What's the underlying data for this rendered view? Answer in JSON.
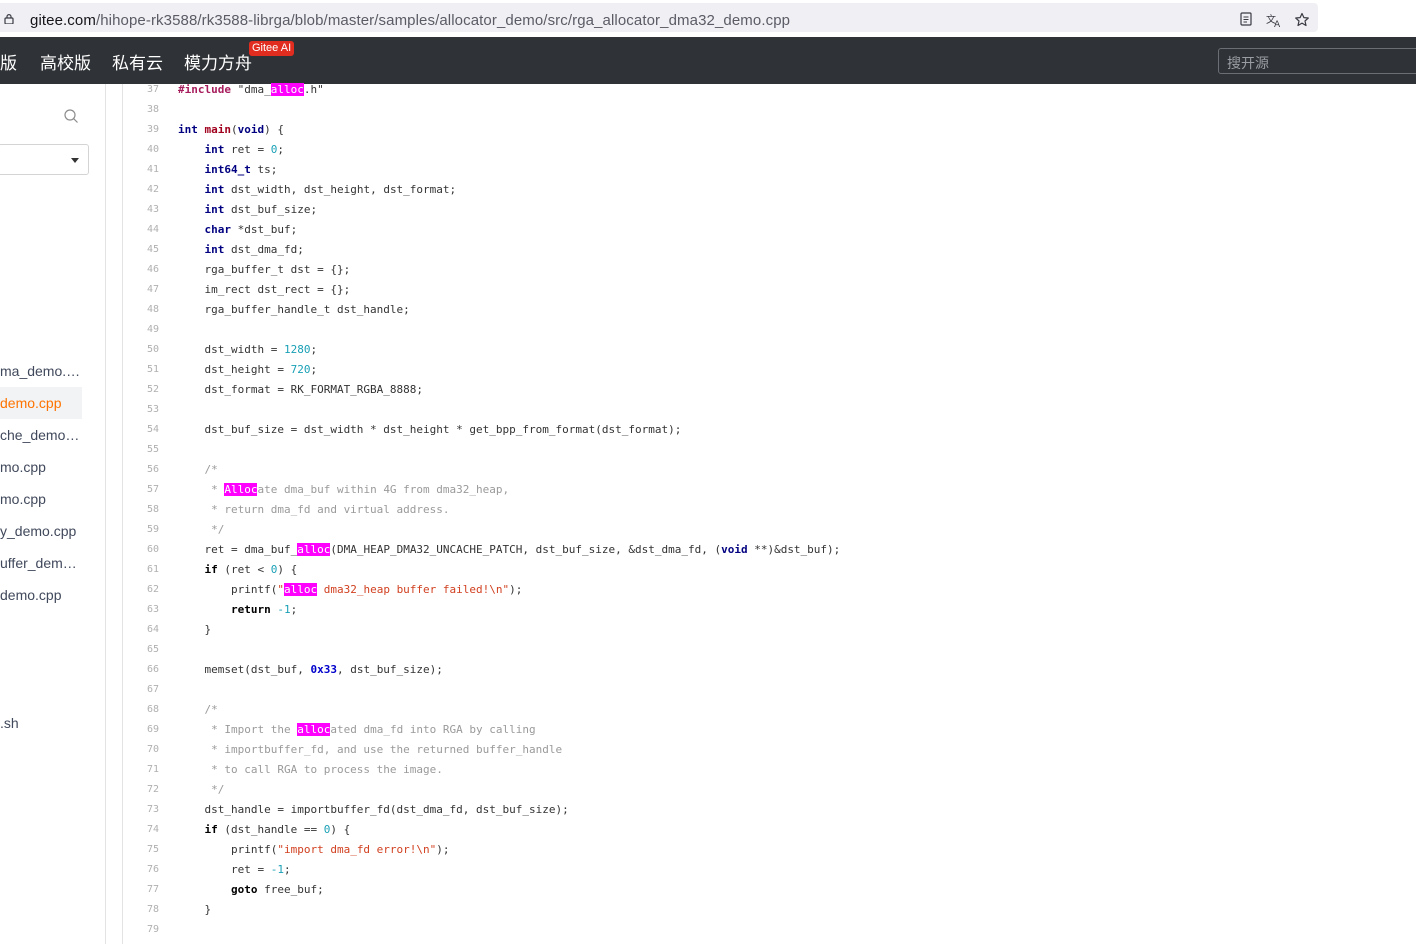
{
  "browser": {
    "url_host": "gitee.com",
    "url_path": "/hihope-rk3588/rk3588-librga/blob/master/samples/allocator_demo/src/rga_allocator_dma32_demo.cpp",
    "icons": [
      "lock-icon",
      "reader-icon",
      "translate-icon",
      "bookmark-star-icon"
    ]
  },
  "nav": {
    "items": [
      "版",
      "高校版",
      "私有云",
      "模力方舟"
    ],
    "badge": "Gitee AI",
    "search_placeholder": "搜开源"
  },
  "sidebar": {
    "files": [
      "ma_demo.cpp",
      "demo.cpp",
      "che_demo.cpp",
      "mo.cpp",
      "mo.cpp",
      "y_demo.cpp",
      "uffer_demo.cpp",
      "demo.cpp",
      ".sh"
    ],
    "active_index": 1
  },
  "code": {
    "lines": [
      {
        "n": "37",
        "tokens": [
          [
            "pp",
            "#include "
          ],
          [
            "",
            "\"dma_"
          ],
          [
            "hl",
            "alloc"
          ],
          [
            "",
            ".h\""
          ]
        ]
      },
      {
        "n": "38",
        "tokens": []
      },
      {
        "n": "39",
        "tokens": [
          [
            "kw",
            "int "
          ],
          [
            "fn",
            "main"
          ],
          [
            "",
            "("
          ],
          [
            "kw",
            "void"
          ],
          [
            "",
            ") {"
          ]
        ]
      },
      {
        "n": "40",
        "tokens": [
          [
            "",
            "    "
          ],
          [
            "kw",
            "int"
          ],
          [
            "",
            " ret = "
          ],
          [
            "num",
            "0"
          ],
          [
            "",
            ";"
          ]
        ]
      },
      {
        "n": "41",
        "tokens": [
          [
            "",
            "    "
          ],
          [
            "kw",
            "int64_t"
          ],
          [
            "",
            " ts;"
          ]
        ]
      },
      {
        "n": "42",
        "tokens": [
          [
            "",
            "    "
          ],
          [
            "kw",
            "int"
          ],
          [
            "",
            " dst_width, dst_height, dst_format;"
          ]
        ]
      },
      {
        "n": "43",
        "tokens": [
          [
            "",
            "    "
          ],
          [
            "kw",
            "int"
          ],
          [
            "",
            " dst_buf_size;"
          ]
        ]
      },
      {
        "n": "44",
        "tokens": [
          [
            "",
            "    "
          ],
          [
            "kw",
            "char"
          ],
          [
            "",
            " *dst_buf;"
          ]
        ]
      },
      {
        "n": "45",
        "tokens": [
          [
            "",
            "    "
          ],
          [
            "kw",
            "int"
          ],
          [
            "",
            " dst_dma_fd;"
          ]
        ]
      },
      {
        "n": "46",
        "tokens": [
          [
            "",
            "    rga_buffer_t dst = {};"
          ]
        ]
      },
      {
        "n": "47",
        "tokens": [
          [
            "",
            "    im_rect dst_rect = {};"
          ]
        ]
      },
      {
        "n": "48",
        "tokens": [
          [
            "",
            "    rga_buffer_handle_t dst_handle;"
          ]
        ]
      },
      {
        "n": "49",
        "tokens": []
      },
      {
        "n": "50",
        "tokens": [
          [
            "",
            "    dst_width = "
          ],
          [
            "num",
            "1280"
          ],
          [
            "",
            ";"
          ]
        ]
      },
      {
        "n": "51",
        "tokens": [
          [
            "",
            "    dst_height = "
          ],
          [
            "num",
            "720"
          ],
          [
            "",
            ";"
          ]
        ]
      },
      {
        "n": "52",
        "tokens": [
          [
            "",
            "    dst_format = RK_FORMAT_RGBA_8888;"
          ]
        ]
      },
      {
        "n": "53",
        "tokens": []
      },
      {
        "n": "54",
        "tokens": [
          [
            "",
            "    dst_buf_size = dst_width * dst_height * get_bpp_from_format(dst_format);"
          ]
        ]
      },
      {
        "n": "55",
        "tokens": []
      },
      {
        "n": "56",
        "tokens": [
          [
            "cm",
            "    /*"
          ]
        ]
      },
      {
        "n": "57",
        "tokens": [
          [
            "cm",
            "     * "
          ],
          [
            "hl",
            "Alloc"
          ],
          [
            "cm",
            "ate dma_buf within 4G from dma32_heap,"
          ]
        ]
      },
      {
        "n": "58",
        "tokens": [
          [
            "cm",
            "     * return dma_fd and virtual address."
          ]
        ]
      },
      {
        "n": "59",
        "tokens": [
          [
            "cm",
            "     */"
          ]
        ]
      },
      {
        "n": "60",
        "tokens": [
          [
            "",
            "    ret = dma_buf_"
          ],
          [
            "hl",
            "alloc"
          ],
          [
            "",
            "(DMA_HEAP_DMA32_UNCACHE_PATCH, dst_buf_size, &dst_dma_fd, ("
          ],
          [
            "kw",
            "void"
          ],
          [
            "",
            " **)&dst_buf);"
          ]
        ]
      },
      {
        "n": "61",
        "tokens": [
          [
            "",
            "    "
          ],
          [
            "kw2",
            "if"
          ],
          [
            "",
            " (ret < "
          ],
          [
            "num",
            "0"
          ],
          [
            "",
            ") {"
          ]
        ]
      },
      {
        "n": "62",
        "tokens": [
          [
            "",
            "        printf("
          ],
          [
            "str",
            "\""
          ],
          [
            "hl",
            "alloc"
          ],
          [
            "str",
            " dma32_heap buffer failed!\\n\""
          ],
          [
            "",
            ");"
          ]
        ]
      },
      {
        "n": "63",
        "tokens": [
          [
            "",
            "        "
          ],
          [
            "kw2",
            "return"
          ],
          [
            "",
            " "
          ],
          [
            "num",
            "-1"
          ],
          [
            "",
            ";"
          ]
        ]
      },
      {
        "n": "64",
        "tokens": [
          [
            "",
            "    }"
          ]
        ]
      },
      {
        "n": "65",
        "tokens": []
      },
      {
        "n": "66",
        "tokens": [
          [
            "",
            "    memset(dst_buf, "
          ],
          [
            "hex",
            "0x33"
          ],
          [
            "",
            ", dst_buf_size);"
          ]
        ]
      },
      {
        "n": "67",
        "tokens": []
      },
      {
        "n": "68",
        "tokens": [
          [
            "cm",
            "    /*"
          ]
        ]
      },
      {
        "n": "69",
        "tokens": [
          [
            "cm",
            "     * Import the "
          ],
          [
            "hl",
            "alloc"
          ],
          [
            "cm",
            "ated dma_fd into RGA by calling"
          ]
        ]
      },
      {
        "n": "70",
        "tokens": [
          [
            "cm",
            "     * importbuffer_fd, and use the returned buffer_handle"
          ]
        ]
      },
      {
        "n": "71",
        "tokens": [
          [
            "cm",
            "     * to call RGA to process the image."
          ]
        ]
      },
      {
        "n": "72",
        "tokens": [
          [
            "cm",
            "     */"
          ]
        ]
      },
      {
        "n": "73",
        "tokens": [
          [
            "",
            "    dst_handle = importbuffer_fd(dst_dma_fd, dst_buf_size);"
          ]
        ]
      },
      {
        "n": "74",
        "tokens": [
          [
            "",
            "    "
          ],
          [
            "kw2",
            "if"
          ],
          [
            "",
            " (dst_handle == "
          ],
          [
            "num",
            "0"
          ],
          [
            "",
            ") {"
          ]
        ]
      },
      {
        "n": "75",
        "tokens": [
          [
            "",
            "        printf("
          ],
          [
            "str",
            "\"import dma_fd error!\\n\""
          ],
          [
            "",
            ");"
          ]
        ]
      },
      {
        "n": "76",
        "tokens": [
          [
            "",
            "        ret = "
          ],
          [
            "num",
            "-1"
          ],
          [
            "",
            ";"
          ]
        ]
      },
      {
        "n": "77",
        "tokens": [
          [
            "",
            "        "
          ],
          [
            "kw2",
            "goto"
          ],
          [
            "",
            " free_buf;"
          ]
        ]
      },
      {
        "n": "78",
        "tokens": [
          [
            "",
            "    }"
          ]
        ]
      },
      {
        "n": "79",
        "tokens": []
      }
    ]
  }
}
